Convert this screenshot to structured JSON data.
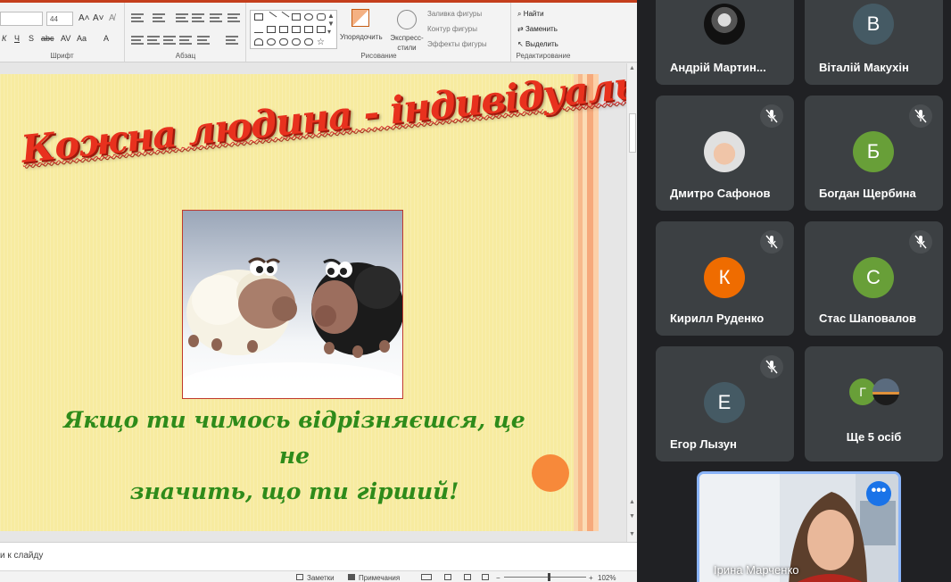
{
  "ribbon": {
    "font_group_label": "Шрифт",
    "paragraph_group_label": "Абзац",
    "drawing_group_label": "Рисование",
    "editing_group_label": "Редактирование",
    "font_size": "44",
    "arrange_label": "Упорядочить",
    "quick_styles_label": "Экспресс-стили",
    "shape_fill_label": "Заливка фигуры",
    "shape_outline_label": "Контур фигуры",
    "shape_effects_label": "Эффекты фигуры",
    "find_label": "Найти",
    "replace_label": "Заменить",
    "select_label": "Выделить"
  },
  "slide": {
    "title": "Кожна людина - індивідуальна",
    "caption_line1": "Якщо ти чимось відрізняєшся, це не",
    "caption_line2": "значить, що ти гірший!"
  },
  "notes": {
    "text": "и к слайду"
  },
  "status_bar": {
    "notes_label": "Заметки",
    "comments_label": "Примечания",
    "zoom": "102%"
  },
  "meet": {
    "participants": [
      {
        "name": "Андрій Мартин...",
        "type": "photo",
        "muted": false
      },
      {
        "name": "Віталій Макухін",
        "initial": "В",
        "color": "#455a64",
        "muted": false
      },
      {
        "name": "Дмитро Сафонов",
        "type": "photo",
        "muted": true
      },
      {
        "name": "Богдан Щербина",
        "initial": "Б",
        "color": "#689f38",
        "muted": true
      },
      {
        "name": "Кирилл Руденко",
        "initial": "К",
        "color": "#ef6c00",
        "muted": true
      },
      {
        "name": "Стас Шаповалов",
        "initial": "С",
        "color": "#689f38",
        "muted": true
      },
      {
        "name": "Егор Лызун",
        "initial": "Е",
        "color": "#455a64",
        "muted": true
      },
      {
        "name": "Ще 5 осіб",
        "initial": "Г",
        "color": "#689f38",
        "muted": false
      }
    ],
    "self": {
      "name": "Ірина Марченко"
    }
  },
  "colors": {
    "accent": "#c43e1c",
    "meet_bg": "#202124",
    "tile_bg": "#3c4043",
    "self_border": "#8ab4f8"
  }
}
